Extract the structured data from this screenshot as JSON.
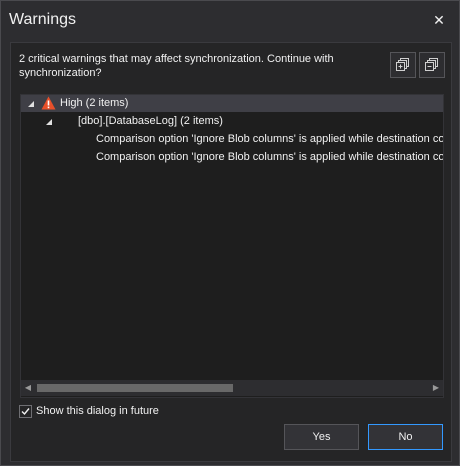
{
  "window": {
    "title": "Warnings",
    "close_glyph": "✕"
  },
  "message": "2 critical warnings that may affect synchronization. Continue with synchronization?",
  "toolbar": {
    "expand_icon": "expand-all-icon",
    "collapse_icon": "collapse-all-icon"
  },
  "tree": {
    "group": {
      "label": "High (2 items)",
      "icon": "warning-icon",
      "severity_color": "#e8502a"
    },
    "object": {
      "label": "[dbo].[DatabaseLog] (2 items)"
    },
    "items": [
      {
        "label": "Comparison option 'Ignore Blob columns' is applied while destination colur"
      },
      {
        "label": "Comparison option 'Ignore Blob columns' is applied while destination colur"
      }
    ]
  },
  "checkbox": {
    "label": "Show this dialog in future",
    "checked": true
  },
  "buttons": {
    "yes": "Yes",
    "no": "No"
  },
  "colors": {
    "accent": "#3399ff",
    "background": "#2d2d30",
    "panel": "#252526"
  }
}
